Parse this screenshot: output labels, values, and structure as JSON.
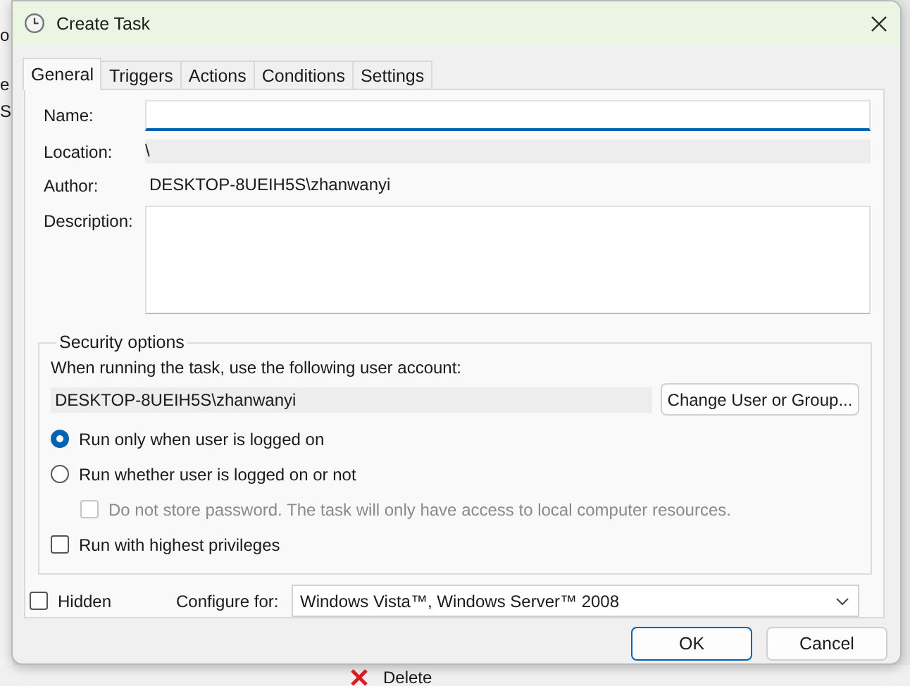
{
  "background_window": {
    "side_texts": [
      "o",
      "e",
      "S"
    ],
    "toolbar_item": "Delete"
  },
  "window": {
    "title": "Create Task"
  },
  "tabs": [
    {
      "label": "General",
      "selected": true
    },
    {
      "label": "Triggers",
      "selected": false
    },
    {
      "label": "Actions",
      "selected": false
    },
    {
      "label": "Conditions",
      "selected": false
    },
    {
      "label": "Settings",
      "selected": false
    }
  ],
  "general": {
    "name": {
      "label": "Name:",
      "focused": true
    },
    "location": {
      "label": "Location:",
      "value": "\\"
    },
    "author": {
      "label": "Author:",
      "value": "DESKTOP-8UEIH5S\\zhanwanyi"
    },
    "description": {
      "label": "Description:"
    },
    "security": {
      "title": "Security options",
      "prompt": "When running the task, use the following user account:",
      "account": "DESKTOP-8UEIH5S\\zhanwanyi",
      "change_button": "Change User or Group...",
      "options": [
        {
          "kind": "radio",
          "label": "Run only when user is logged on",
          "selected": true,
          "disabled": false
        },
        {
          "kind": "radio",
          "label": "Run whether user is logged on or not",
          "selected": false,
          "disabled": false,
          "children": [
            {
              "kind": "checkbox",
              "label": "Do not store password.  The task will only have access to local computer resources.",
              "checked": false,
              "disabled": true
            }
          ]
        },
        {
          "kind": "checkbox",
          "label": "Run with highest privileges",
          "checked": false,
          "disabled": false
        }
      ]
    },
    "hidden": {
      "label": "Hidden",
      "checked": false
    },
    "configure": {
      "label": "Configure for:",
      "value": "Windows Vista™, Windows Server™ 2008"
    }
  },
  "buttons": [
    {
      "label": "OK",
      "default": true
    },
    {
      "label": "Cancel",
      "default": false
    }
  ]
}
